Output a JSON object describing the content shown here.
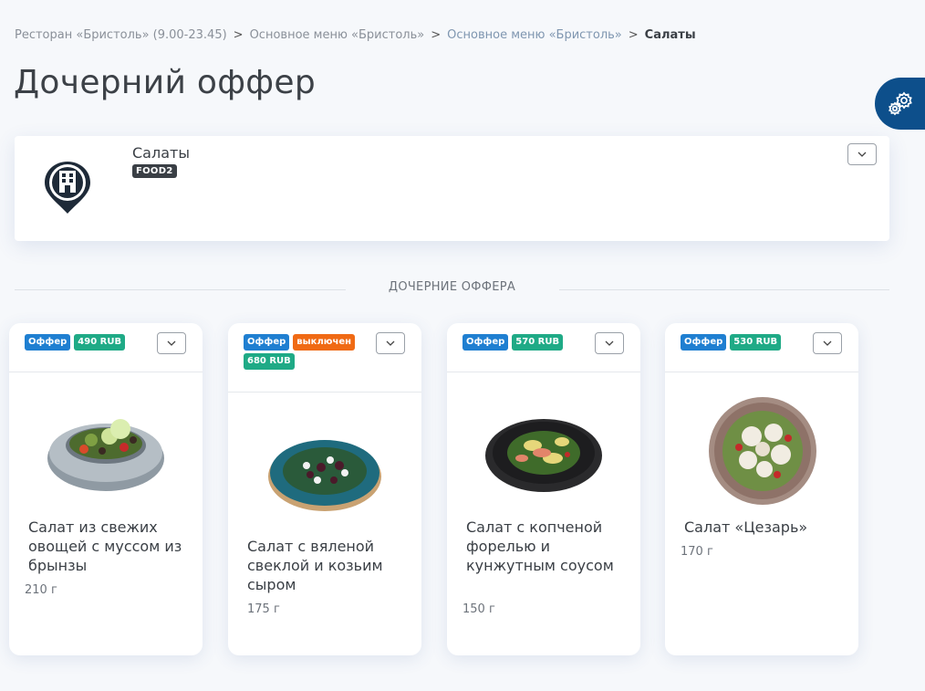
{
  "breadcrumb": {
    "item1": "Ресторан «Бристоль» (9.00-23.45)",
    "item2": "Основное меню «Бристоль»",
    "item3": "Основное меню «Бристоль»",
    "current": "Салаты",
    "separator": ">"
  },
  "page": {
    "title": "Дочерний оффер"
  },
  "header_card": {
    "name": "Салаты",
    "code": "FOOD2"
  },
  "section": {
    "title": "ДОЧЕРНИЕ ОФФЕРА"
  },
  "offers": [
    {
      "badge_type": "Оффер",
      "price": "490 RUB",
      "status": "",
      "name": "Салат из свежих овощей с муссом из брынзы",
      "weight": "210 г"
    },
    {
      "badge_type": "Оффер",
      "price": "680 RUB",
      "status": "выключен",
      "name": "Салат с вяленой свеклой и козьим сыром",
      "weight": "175 г"
    },
    {
      "badge_type": "Оффер",
      "price": "570 RUB",
      "status": "",
      "name": "Салат с копченой форелью и кунжутным соусом",
      "weight": "150 г"
    },
    {
      "badge_type": "Оффер",
      "price": "530 RUB",
      "status": "",
      "name": "Салат «Цезарь»",
      "weight": "170 г"
    }
  ],
  "colors": {
    "accent": "#0d4f8b",
    "offer_badge": "#1f7fd1",
    "price_badge": "#1faa86",
    "disabled_badge": "#f06a14"
  },
  "icons": {
    "settings": "gear-icon",
    "location": "building-pin-icon",
    "dropdown": "chevron-down-icon"
  }
}
